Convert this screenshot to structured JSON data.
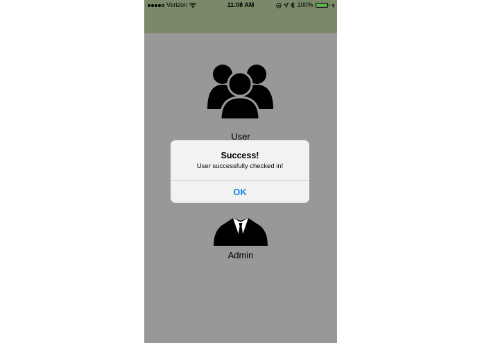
{
  "status_bar": {
    "carrier": "Verizon",
    "time": "11:08 AM",
    "battery_percent": "100%",
    "signal_bars_filled": 4,
    "signal_bars_total": 5,
    "battery_level": 1.0,
    "bar_color": "#7a8a68",
    "battery_color": "#44c041"
  },
  "screen": {
    "background_color": "#989898",
    "options": [
      {
        "label": "User",
        "icon": "group-users-icon"
      },
      {
        "label": "Admin",
        "icon": "admin-suit-icon"
      }
    ]
  },
  "alert": {
    "title": "Success!",
    "message": "User successfully checked in!",
    "button_label": "OK",
    "button_color": "#1a7ff5"
  }
}
